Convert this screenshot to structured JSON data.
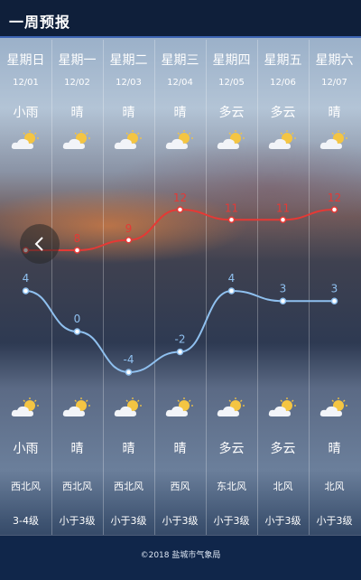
{
  "header": {
    "title": "一周预报"
  },
  "days": [
    {
      "day": "星期日",
      "date": "12/01",
      "cond_top": "小雨",
      "cond_bot": "小雨",
      "wind_dir": "西北风",
      "wind_lvl": "3-4级",
      "high": "",
      "low": "4"
    },
    {
      "day": "星期一",
      "date": "12/02",
      "cond_top": "晴",
      "cond_bot": "晴",
      "wind_dir": "西北风",
      "wind_lvl": "小于3级",
      "high": "8",
      "low": "0"
    },
    {
      "day": "星期二",
      "date": "12/03",
      "cond_top": "晴",
      "cond_bot": "晴",
      "wind_dir": "西北风",
      "wind_lvl": "小于3级",
      "high": "9",
      "low": "-4"
    },
    {
      "day": "星期三",
      "date": "12/04",
      "cond_top": "晴",
      "cond_bot": "晴",
      "wind_dir": "西风",
      "wind_lvl": "小于3级",
      "high": "12",
      "low": "-2"
    },
    {
      "day": "星期四",
      "date": "12/05",
      "cond_top": "多云",
      "cond_bot": "多云",
      "wind_dir": "东北风",
      "wind_lvl": "小于3级",
      "high": "11",
      "low": "4"
    },
    {
      "day": "星期五",
      "date": "12/06",
      "cond_top": "多云",
      "cond_bot": "多云",
      "wind_dir": "北风",
      "wind_lvl": "小于3级",
      "high": "11",
      "low": "3"
    },
    {
      "day": "星期六",
      "date": "12/07",
      "cond_top": "晴",
      "cond_bot": "晴",
      "wind_dir": "北风",
      "wind_lvl": "小于3级",
      "high": "12",
      "low": "3"
    }
  ],
  "icons": {
    "weather": "sun-behind-cloud-icon",
    "nav": "chevron-left-icon"
  },
  "colors": {
    "high_line": "#e53935",
    "low_line": "#8fc0ef",
    "header_bg": "#0f1f3a",
    "header_border": "#3d64b3",
    "footer_bg": "#10264a"
  },
  "footer": {
    "text": "©2018 盐城市气象局"
  }
}
